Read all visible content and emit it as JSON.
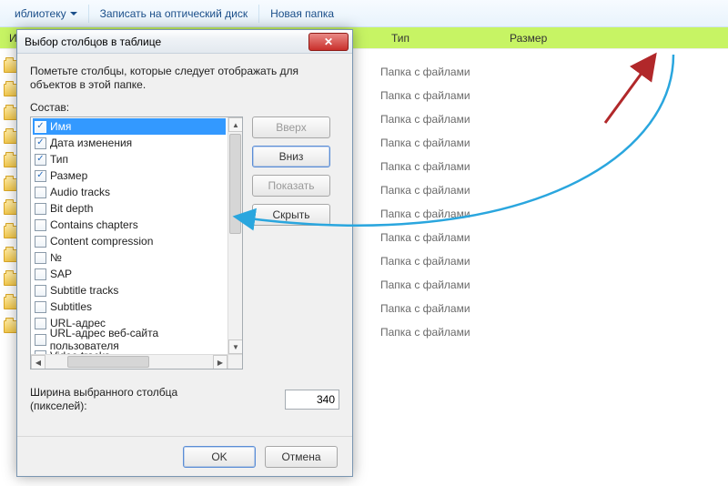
{
  "toolbar": {
    "library": "иблиотеку",
    "burn": "Записать на оптический диск",
    "new_folder": "Новая папка"
  },
  "columns": {
    "name": "Имя",
    "type": "Тип",
    "size": "Размер"
  },
  "file_type_value": "Папка с файлами",
  "file_rows": 12,
  "dialog": {
    "title": "Выбор столбцов в таблице",
    "instruction": "Пометьте столбцы, которые следует отображать для объектов в этой папке.",
    "list_label": "Состав:",
    "items": [
      {
        "label": "Имя",
        "checked": true,
        "selected": true
      },
      {
        "label": "Дата изменения",
        "checked": true,
        "selected": false
      },
      {
        "label": "Тип",
        "checked": true,
        "selected": false
      },
      {
        "label": "Размер",
        "checked": true,
        "selected": false
      },
      {
        "label": "Audio tracks",
        "checked": false,
        "selected": false
      },
      {
        "label": "Bit depth",
        "checked": false,
        "selected": false
      },
      {
        "label": "Contains chapters",
        "checked": false,
        "selected": false
      },
      {
        "label": "Content compression",
        "checked": false,
        "selected": false
      },
      {
        "label": "№",
        "checked": false,
        "selected": false
      },
      {
        "label": "SAP",
        "checked": false,
        "selected": false
      },
      {
        "label": "Subtitle tracks",
        "checked": false,
        "selected": false
      },
      {
        "label": "Subtitles",
        "checked": false,
        "selected": false
      },
      {
        "label": "URL-адрес",
        "checked": false,
        "selected": false
      },
      {
        "label": "URL-адрес веб-сайта пользователя",
        "checked": false,
        "selected": false
      },
      {
        "label": "Video tracks",
        "checked": false,
        "selected": false
      }
    ],
    "buttons": {
      "up": "Вверх",
      "down": "Вниз",
      "show": "Показать",
      "hide": "Скрыть",
      "ok": "OK",
      "cancel": "Отмена"
    },
    "width_label": "Ширина выбранного столбца (пикселей):",
    "width_value": "340"
  }
}
